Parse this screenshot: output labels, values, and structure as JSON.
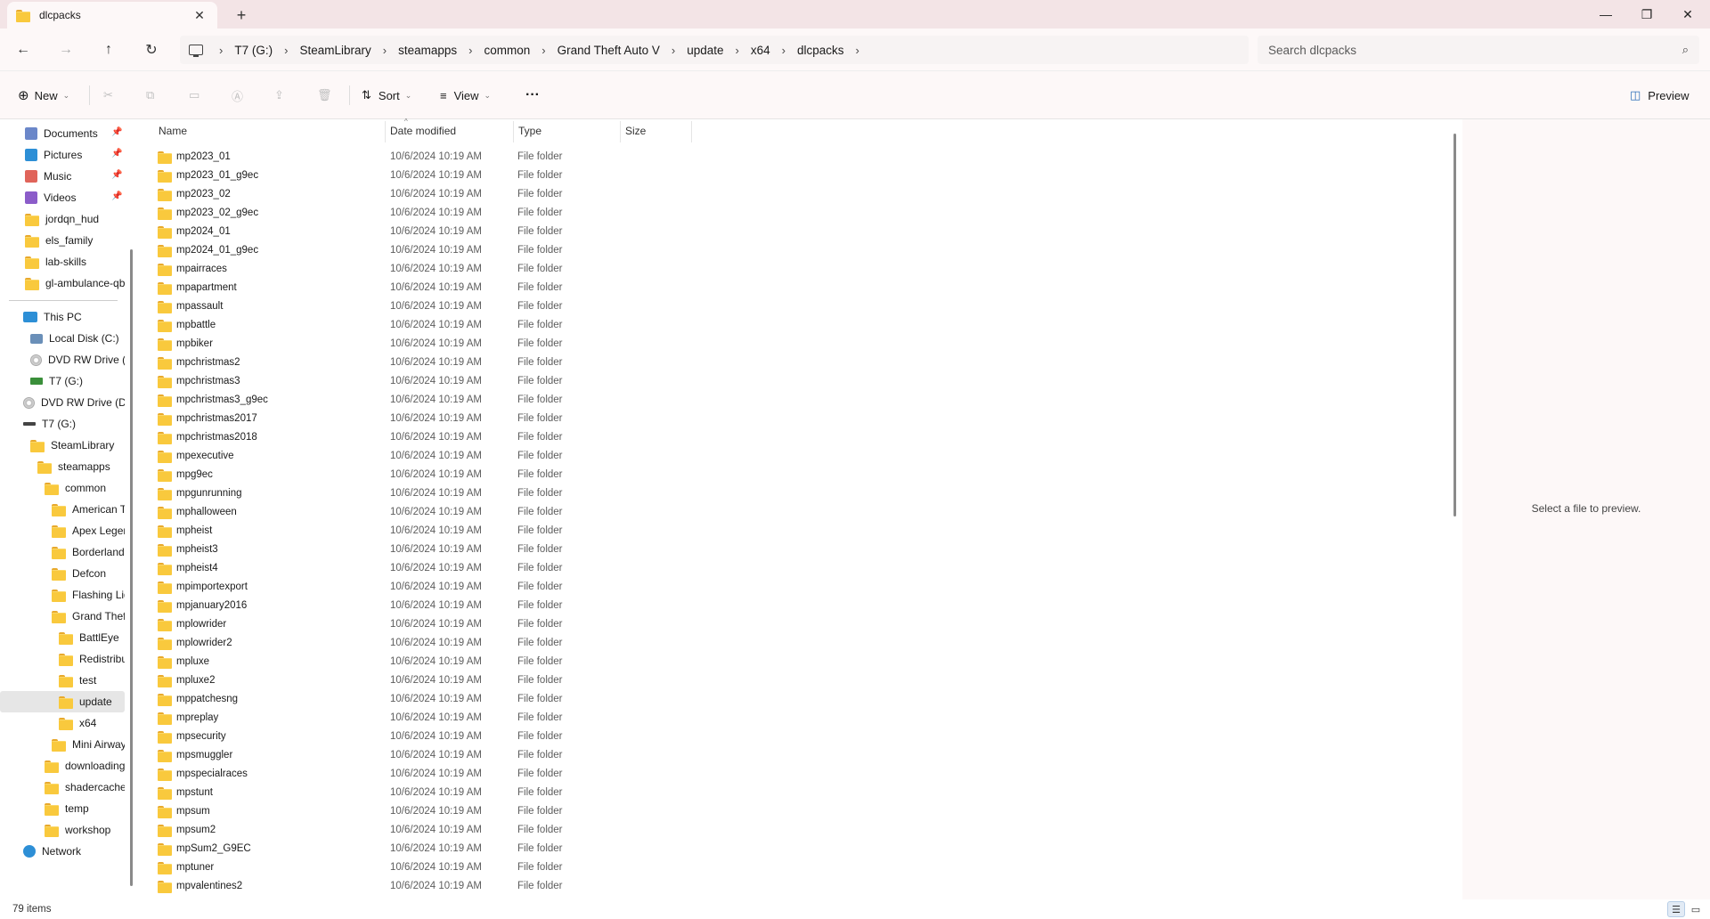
{
  "window": {
    "tab_title": "dlcpacks",
    "new_tab": "+",
    "minimize": "—",
    "restore": "❐",
    "close": "✕"
  },
  "breadcrumb": [
    "T7 (G:)",
    "SteamLibrary",
    "steamapps",
    "common",
    "Grand Theft Auto V",
    "update",
    "x64",
    "dlcpacks"
  ],
  "search": {
    "placeholder": "Search dlcpacks"
  },
  "commands": {
    "new_label": "New",
    "sort_label": "Sort",
    "view_label": "View",
    "more_label": "···",
    "preview_label": "Preview"
  },
  "sidebar": {
    "pinned": [
      {
        "label": "Documents",
        "icon": "documents-icon",
        "color": "#6b87c9"
      },
      {
        "label": "Pictures",
        "icon": "pictures-icon",
        "color": "#2d8fd6"
      },
      {
        "label": "Music",
        "icon": "music-icon",
        "color": "#e0645a"
      },
      {
        "label": "Videos",
        "icon": "videos-icon",
        "color": "#8b5cc9"
      }
    ],
    "folders": [
      "jordqn_hud",
      "els_family",
      "lab-skills",
      "gl-ambulance-qb"
    ],
    "this_pc": "This PC",
    "drives": [
      "Local Disk (C:)",
      "DVD RW Drive (I",
      "T7 (G:)",
      "DVD RW Drive (D:",
      "T7 (G:)"
    ],
    "tree": [
      {
        "label": "SteamLibrary",
        "indent": 1
      },
      {
        "label": "steamapps",
        "indent": 2
      },
      {
        "label": "common",
        "indent": 3
      },
      {
        "label": "American T",
        "indent": 4
      },
      {
        "label": "Apex Legen",
        "indent": 4
      },
      {
        "label": "Borderlands",
        "indent": 4
      },
      {
        "label": "Defcon",
        "indent": 4
      },
      {
        "label": "Flashing Lig",
        "indent": 4
      },
      {
        "label": "Grand Theft",
        "indent": 4
      },
      {
        "label": "BattlEye",
        "indent": 5
      },
      {
        "label": "Redistribu",
        "indent": 5
      },
      {
        "label": "test",
        "indent": 5
      },
      {
        "label": "update",
        "indent": 5,
        "selected": true
      },
      {
        "label": "x64",
        "indent": 5
      },
      {
        "label": "Mini Airway",
        "indent": 4
      },
      {
        "label": "downloading",
        "indent": 3
      },
      {
        "label": "shadercache",
        "indent": 3
      },
      {
        "label": "temp",
        "indent": 3
      },
      {
        "label": "workshop",
        "indent": 3
      }
    ],
    "network": "Network"
  },
  "columns": {
    "name": "Name",
    "date": "Date modified",
    "type": "Type",
    "size": "Size"
  },
  "files": [
    {
      "name": "mp2023_01",
      "date": "10/6/2024 10:19 AM",
      "type": "File folder"
    },
    {
      "name": "mp2023_01_g9ec",
      "date": "10/6/2024 10:19 AM",
      "type": "File folder"
    },
    {
      "name": "mp2023_02",
      "date": "10/6/2024 10:19 AM",
      "type": "File folder"
    },
    {
      "name": "mp2023_02_g9ec",
      "date": "10/6/2024 10:19 AM",
      "type": "File folder"
    },
    {
      "name": "mp2024_01",
      "date": "10/6/2024 10:19 AM",
      "type": "File folder"
    },
    {
      "name": "mp2024_01_g9ec",
      "date": "10/6/2024 10:19 AM",
      "type": "File folder"
    },
    {
      "name": "mpairraces",
      "date": "10/6/2024 10:19 AM",
      "type": "File folder"
    },
    {
      "name": "mpapartment",
      "date": "10/6/2024 10:19 AM",
      "type": "File folder"
    },
    {
      "name": "mpassault",
      "date": "10/6/2024 10:19 AM",
      "type": "File folder"
    },
    {
      "name": "mpbattle",
      "date": "10/6/2024 10:19 AM",
      "type": "File folder"
    },
    {
      "name": "mpbiker",
      "date": "10/6/2024 10:19 AM",
      "type": "File folder"
    },
    {
      "name": "mpchristmas2",
      "date": "10/6/2024 10:19 AM",
      "type": "File folder"
    },
    {
      "name": "mpchristmas3",
      "date": "10/6/2024 10:19 AM",
      "type": "File folder"
    },
    {
      "name": "mpchristmas3_g9ec",
      "date": "10/6/2024 10:19 AM",
      "type": "File folder"
    },
    {
      "name": "mpchristmas2017",
      "date": "10/6/2024 10:19 AM",
      "type": "File folder"
    },
    {
      "name": "mpchristmas2018",
      "date": "10/6/2024 10:19 AM",
      "type": "File folder"
    },
    {
      "name": "mpexecutive",
      "date": "10/6/2024 10:19 AM",
      "type": "File folder"
    },
    {
      "name": "mpg9ec",
      "date": "10/6/2024 10:19 AM",
      "type": "File folder"
    },
    {
      "name": "mpgunrunning",
      "date": "10/6/2024 10:19 AM",
      "type": "File folder"
    },
    {
      "name": "mphalloween",
      "date": "10/6/2024 10:19 AM",
      "type": "File folder"
    },
    {
      "name": "mpheist",
      "date": "10/6/2024 10:19 AM",
      "type": "File folder"
    },
    {
      "name": "mpheist3",
      "date": "10/6/2024 10:19 AM",
      "type": "File folder"
    },
    {
      "name": "mpheist4",
      "date": "10/6/2024 10:19 AM",
      "type": "File folder"
    },
    {
      "name": "mpimportexport",
      "date": "10/6/2024 10:19 AM",
      "type": "File folder"
    },
    {
      "name": "mpjanuary2016",
      "date": "10/6/2024 10:19 AM",
      "type": "File folder"
    },
    {
      "name": "mplowrider",
      "date": "10/6/2024 10:19 AM",
      "type": "File folder"
    },
    {
      "name": "mplowrider2",
      "date": "10/6/2024 10:19 AM",
      "type": "File folder"
    },
    {
      "name": "mpluxe",
      "date": "10/6/2024 10:19 AM",
      "type": "File folder"
    },
    {
      "name": "mpluxe2",
      "date": "10/6/2024 10:19 AM",
      "type": "File folder"
    },
    {
      "name": "mppatchesng",
      "date": "10/6/2024 10:19 AM",
      "type": "File folder"
    },
    {
      "name": "mpreplay",
      "date": "10/6/2024 10:19 AM",
      "type": "File folder"
    },
    {
      "name": "mpsecurity",
      "date": "10/6/2024 10:19 AM",
      "type": "File folder"
    },
    {
      "name": "mpsmuggler",
      "date": "10/6/2024 10:19 AM",
      "type": "File folder"
    },
    {
      "name": "mpspecialraces",
      "date": "10/6/2024 10:19 AM",
      "type": "File folder"
    },
    {
      "name": "mpstunt",
      "date": "10/6/2024 10:19 AM",
      "type": "File folder"
    },
    {
      "name": "mpsum",
      "date": "10/6/2024 10:19 AM",
      "type": "File folder"
    },
    {
      "name": "mpsum2",
      "date": "10/6/2024 10:19 AM",
      "type": "File folder"
    },
    {
      "name": "mpSum2_G9EC",
      "date": "10/6/2024 10:19 AM",
      "type": "File folder"
    },
    {
      "name": "mptuner",
      "date": "10/6/2024 10:19 AM",
      "type": "File folder"
    },
    {
      "name": "mpvalentines2",
      "date": "10/6/2024 10:19 AM",
      "type": "File folder"
    }
  ],
  "preview_message": "Select a file to preview.",
  "status": {
    "item_count": "79 items"
  }
}
